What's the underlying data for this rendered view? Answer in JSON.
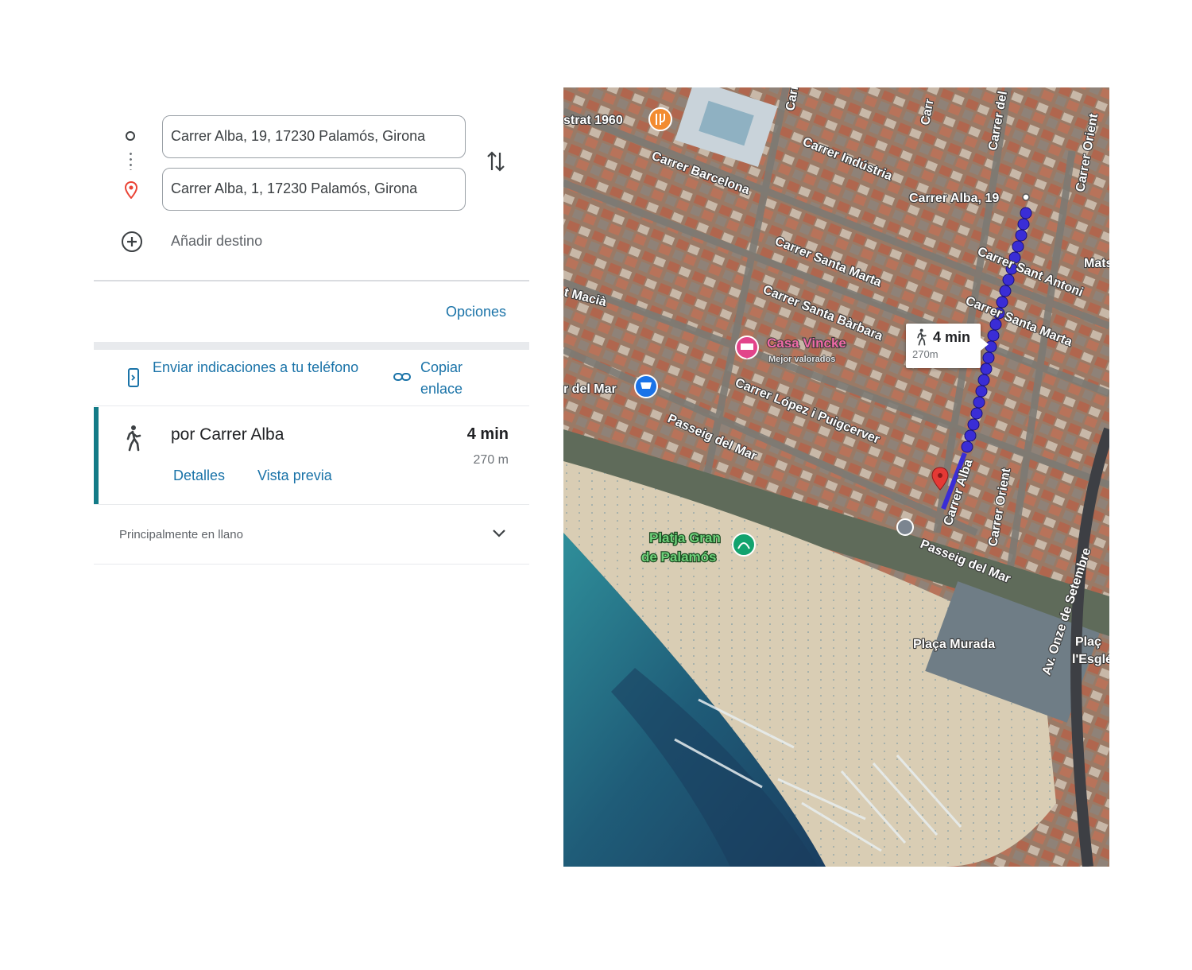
{
  "directions": {
    "origin_value": "Carrer Alba, 19, 17230 Palamós, Girona",
    "destination_value": "Carrer Alba, 1, 17230 Palamós, Girona",
    "add_destination_label": "Añadir destino",
    "options_label": "Opciones",
    "send_to_phone_label": "Enviar indicaciones a tu teléfono",
    "copy_link_label": "Copiar enlace"
  },
  "route": {
    "via_label": "por Carrer Alba",
    "duration": "4 min",
    "distance": "270 m",
    "details_label": "Detalles",
    "preview_label": "Vista previa",
    "terrain_label": "Principalmente en llano"
  },
  "map": {
    "time_bubble": {
      "duration": "4 min",
      "distance": "270m"
    },
    "labels": {
      "restaurant": "strat 1960",
      "carrer_industria": "Carrer Indústria",
      "carrer_barcelona": "Carrer Barcelona",
      "carrer_alba_19": "Carrer Alba, 19",
      "carrer_santa_marta_1": "Carrer Santa Marta",
      "carrer_santa_barbara": "Carrer Santa Bàrbara",
      "carrer_sant_antoni": "Carrer Sant Antoni",
      "carrer_santa_marta_2": "Carrer Santa Marta",
      "macia": "t Macià",
      "casa_vincke": "Casa Vincke",
      "casa_vincke_sub": "Mejor valorados",
      "carrer_lopez": "Carrer López i Puigcerver",
      "passeig_mar_1": "Passeig del Mar",
      "passeig_mar_2": "Passeig del Mar",
      "carrer_alba_road": "Carrer Alba",
      "carrer_orient_1": "Carrer Orient",
      "carrer_orient_2": "Carrer Orient",
      "del_mar": "r del Mar",
      "platja_1": "Platja Gran",
      "platja_2": "de Palamós",
      "placa_murada": "Plaça Murada",
      "av_onze": "Av. Onze de Setembre",
      "mats": "Mats",
      "carrer_del": "Carrer del",
      "carrer_top": "Carrer",
      "carrer_top2": "Carr",
      "placa_right": "Plaç",
      "esglesia": "l'Esglé"
    },
    "colors": {
      "route": "#3a2dd6",
      "water": "#1d5a79",
      "sand": "#d9cdb4"
    }
  },
  "icons": {
    "origin": "circle-outline-icon",
    "destination": "red-pin-icon",
    "swap": "swap-vertical-icon",
    "add": "add-circle-icon",
    "phone": "phone-send-icon",
    "link": "link-icon",
    "walk": "walking-person-icon",
    "chevron": "chevron-down-icon"
  }
}
